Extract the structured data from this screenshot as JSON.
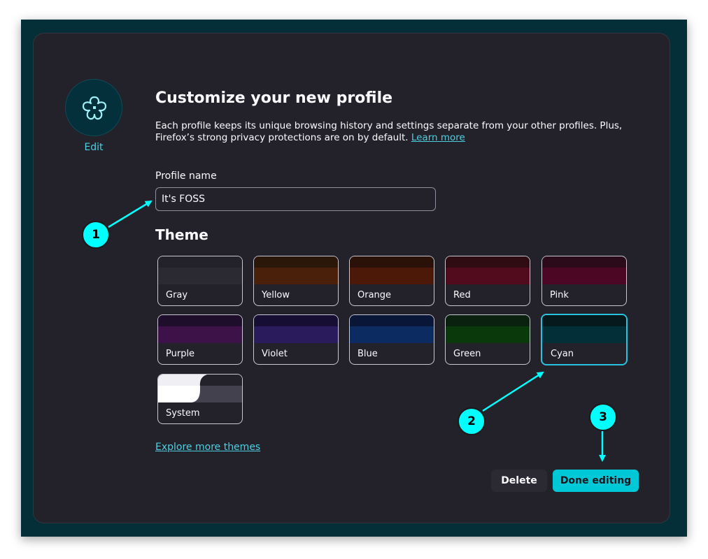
{
  "avatar": {
    "icon": "flower-icon",
    "edit_label": "Edit"
  },
  "header": {
    "title": "Customize your new profile",
    "description": "Each profile keeps its unique browsing history and settings separate from your other profiles. Plus, Firefox’s strong privacy protections are on by default.",
    "learn_more": "Learn more"
  },
  "profile": {
    "label": "Profile name",
    "value": "It's FOSS"
  },
  "theme": {
    "title": "Theme",
    "selected": "Cyan",
    "options": [
      {
        "label": "Gray",
        "top": "#23222b",
        "mid": "#2b2a33"
      },
      {
        "label": "Yellow",
        "top": "#2b1709",
        "mid": "#4a200a"
      },
      {
        "label": "Orange",
        "top": "#2b1209",
        "mid": "#4c1808"
      },
      {
        "label": "Red",
        "top": "#2e0c12",
        "mid": "#520b1c"
      },
      {
        "label": "Pink",
        "top": "#2b0a1a",
        "mid": "#4c0724"
      },
      {
        "label": "Purple",
        "top": "#1f0e2b",
        "mid": "#3c1248"
      },
      {
        "label": "Violet",
        "top": "#170f33",
        "mid": "#2a1b5c"
      },
      {
        "label": "Blue",
        "top": "#0a1638",
        "mid": "#0c2b60"
      },
      {
        "label": "Green",
        "top": "#0a2110",
        "mid": "#0a3a0c"
      },
      {
        "label": "Cyan",
        "top": "#061a1e",
        "mid": "#032f38"
      },
      {
        "label": "System",
        "top": "#f0f0f4",
        "mid": "#ffffff"
      }
    ],
    "explore_more": "Explore more themes"
  },
  "actions": {
    "delete": "Delete",
    "done": "Done editing"
  },
  "callouts": [
    "1",
    "2",
    "3"
  ],
  "colors": {
    "accent": "#00c8d7",
    "callout": "#00ffff",
    "frame": "#042f38",
    "dialog": "#23222b"
  }
}
